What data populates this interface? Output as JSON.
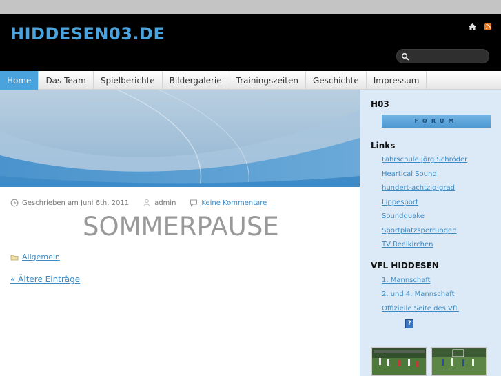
{
  "header": {
    "site_title": "HIDDESEN03.DE",
    "search": {
      "placeholder": "",
      "value": ""
    }
  },
  "nav": {
    "items": [
      {
        "label": "Home",
        "active": true
      },
      {
        "label": "Das Team"
      },
      {
        "label": "Spielberichte"
      },
      {
        "label": "Bildergalerie"
      },
      {
        "label": "Trainingszeiten"
      },
      {
        "label": "Geschichte"
      },
      {
        "label": "Impressum"
      }
    ]
  },
  "post": {
    "meta": {
      "written": "Geschrieben am Juni 6th, 2011",
      "author": "admin",
      "comments": "Keine Kommentare"
    },
    "title": "SOMMERPAUSE",
    "category": "Allgemein"
  },
  "pagination": {
    "older": "« Ältere Einträge"
  },
  "sidebar": {
    "h03": {
      "heading": "H03",
      "forum_label": "FORUM"
    },
    "links": {
      "heading": "Links",
      "items": [
        "Fahrschule Jörg Schröder",
        "Heartical Sound",
        "hundert-achtzig-grad",
        "Lippesport",
        "Soundquake",
        "Sportplatzsperrungen",
        "TV Reelkirchen"
      ]
    },
    "vfl": {
      "heading": "VFL HIDDESEN",
      "items": [
        "1. Mannschaft",
        "2. und 4. Mannschaft",
        "Offizielle Seite des VfL"
      ],
      "help_label": "?"
    }
  },
  "colors": {
    "accent": "#4aa3dd",
    "header_bg": "#000000",
    "sidebar_bg": "#dbeaf6",
    "link": "#3e8bc4"
  },
  "icons": [
    "home-icon",
    "rss-icon",
    "search-icon",
    "clock-icon",
    "author-icon",
    "comment-icon",
    "folder-icon"
  ]
}
